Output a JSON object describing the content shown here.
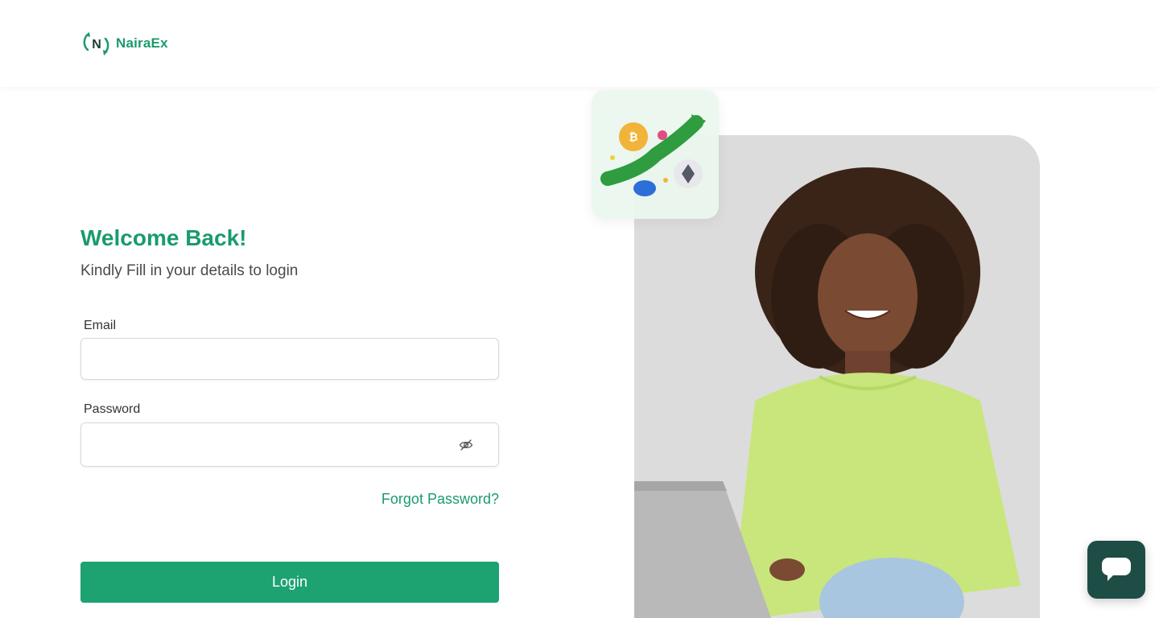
{
  "brand": {
    "name": "NairaEx",
    "icon": "nairaex-logo-icon",
    "color": "#1a9b6b"
  },
  "login": {
    "title": "Welcome Back!",
    "subtitle": "Kindly Fill in your details to login",
    "email_label": "Email",
    "email_value": "",
    "password_label": "Password",
    "password_value": "",
    "password_toggle_icon": "eye-off-icon",
    "forgot_label": "Forgot Password?",
    "submit_label": "Login"
  },
  "hero": {
    "photo": "woman-with-laptop-photo",
    "card_icon": "crypto-growth-illustration"
  },
  "chat": {
    "icon": "chat-bubble-icon"
  },
  "colors": {
    "primary": "#1da272",
    "chat_bg": "#1e4d45"
  }
}
